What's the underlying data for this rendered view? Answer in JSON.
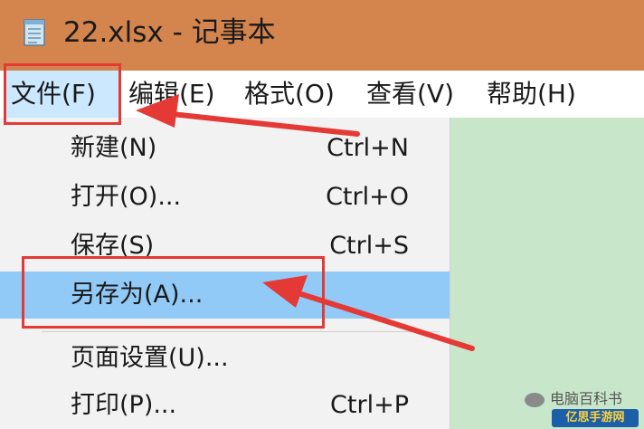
{
  "window": {
    "title": "22.xlsx - 记事本",
    "title_bar_color": "#d4854e"
  },
  "menubar": {
    "items": [
      {
        "label": "文件(F)",
        "active": true
      },
      {
        "label": "编辑(E)"
      },
      {
        "label": "格式(O)"
      },
      {
        "label": "查看(V)"
      },
      {
        "label": "帮助(H)"
      }
    ]
  },
  "file_menu": {
    "items": [
      {
        "label": "新建(N)",
        "shortcut": "Ctrl+N"
      },
      {
        "label": "打开(O)...",
        "shortcut": "Ctrl+O"
      },
      {
        "label": "保存(S)",
        "shortcut": "Ctrl+S"
      },
      {
        "label": "另存为(A)...",
        "shortcut": "",
        "highlighted": true
      },
      {
        "label": "页面设置(U)...",
        "shortcut": ""
      },
      {
        "label": "打印(P)...",
        "shortcut": "Ctrl+P"
      }
    ]
  },
  "annotations": {
    "color": "#e53935"
  },
  "colors": {
    "highlight": "#91c9f7",
    "menu_active": "#cce8ff",
    "editor_bg": "#c8e6c9"
  },
  "watermark": {
    "text": "电脑百科书",
    "logo_text": "亿思手游网"
  }
}
